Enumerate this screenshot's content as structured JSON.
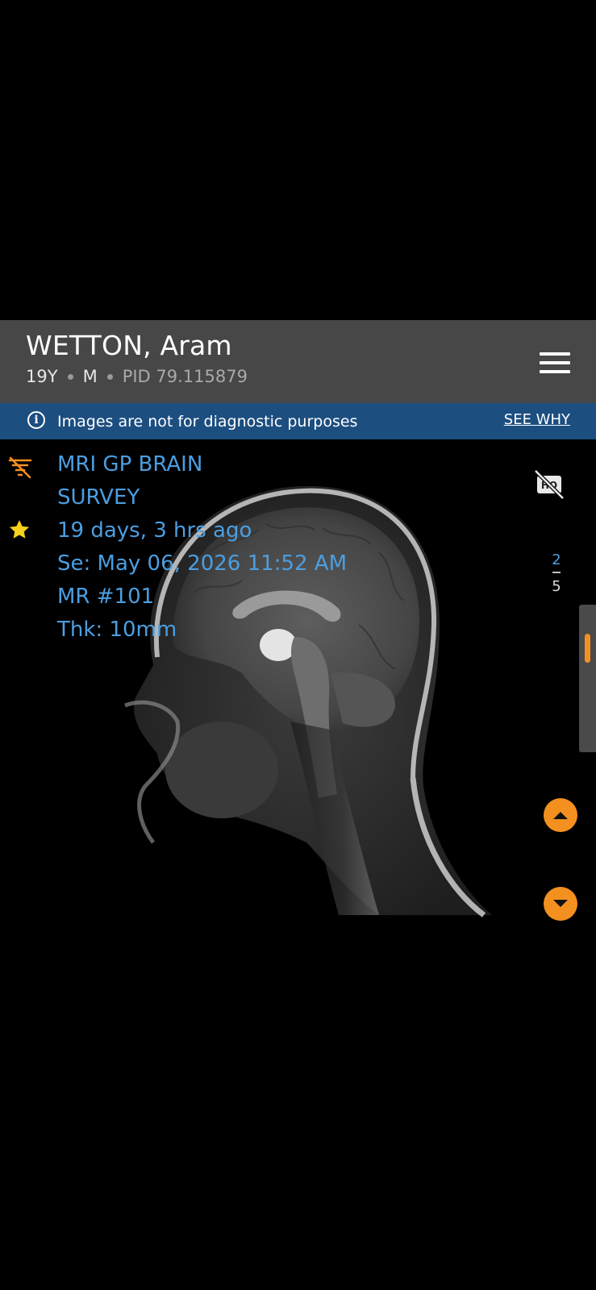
{
  "header": {
    "patient_name": "WETTON, Aram",
    "age": "19Y",
    "sex": "M",
    "pid": "PID 79.115879",
    "menu_icon": "hamburger-menu-icon"
  },
  "banner": {
    "icon": "info-icon",
    "message": "Images are not for diagnostic purposes",
    "link_label": "SEE WHY"
  },
  "study": {
    "title": "MRI GP BRAIN",
    "description": "SURVEY",
    "relative_time": "19 days, 3 hrs ago",
    "series_datetime": "Se: May 06, 2026 11:52 AM",
    "modality_number": "MR #101",
    "thickness": "Thk: 10mm"
  },
  "series_nav": {
    "current": "2",
    "total": "5",
    "hq_icon": "hq-off-icon",
    "up_icon": "arrow-up-icon",
    "down_icon": "arrow-down-icon"
  },
  "icons": {
    "filter": "filter-list-icon",
    "favorite": "star-icon"
  },
  "colors": {
    "header_bg": "#474747",
    "banner_bg": "#1c4e80",
    "overlay_text": "#4c9ee0",
    "accent": "#f39020",
    "star": "#f7d21c"
  }
}
